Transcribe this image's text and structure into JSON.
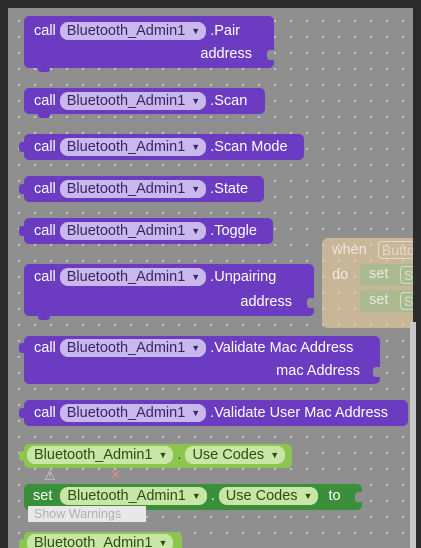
{
  "component": "Bluetooth_Admin1",
  "call": "call",
  "set": "set",
  "to": "to",
  "blocks": {
    "pair": {
      "method": ".Pair",
      "param": "address"
    },
    "scan": {
      "method": ".Scan"
    },
    "scanmode": {
      "method": ".Scan Mode"
    },
    "state": {
      "method": ".State"
    },
    "toggle": {
      "method": ".Toggle"
    },
    "unpair": {
      "method": ".Unpairing",
      "param": "address"
    },
    "validatemac": {
      "method": ".Validate Mac Address",
      "param": "mac Address"
    },
    "validateuser": {
      "method": ".Validate User Mac Address"
    },
    "usecodes_get": {
      "dot": ".",
      "prop": "Use Codes"
    },
    "usecodes_set": {
      "dot": ".",
      "prop": "Use Codes"
    }
  },
  "ghost_event": {
    "when": "when",
    "do": "do",
    "component": "Button",
    "set1": "set",
    "set2": "set",
    "field": "Sc"
  },
  "warnings": {
    "label": "Show Warnings",
    "count_warn": "",
    "count_err": ""
  },
  "colors": {
    "method_block": "#6b3cc2",
    "getter_block": "#8cc64f",
    "setter_block": "#3a8f3a",
    "workspace": "#8f8f8f"
  }
}
